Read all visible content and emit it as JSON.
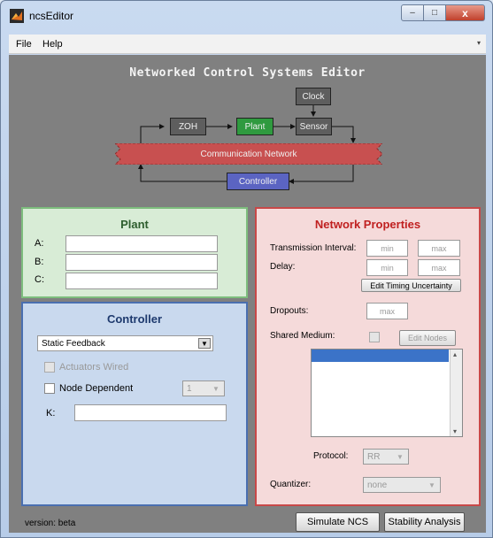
{
  "window": {
    "title": "ncsEditor",
    "min_glyph": "–",
    "max_glyph": "□",
    "close_glyph": "x"
  },
  "menu": {
    "file": "File",
    "help": "Help",
    "arrow_glyph": "▾"
  },
  "app_title": "Networked Control Systems Editor",
  "diagram": {
    "clock": "Clock",
    "zoh": "ZOH",
    "plant": "Plant",
    "sensor": "Sensor",
    "network": "Communication Network",
    "controller": "Controller",
    "colors": {
      "zoh": "#5e5e5e",
      "plant": "#2f9a3f",
      "sensor": "#5e5e5e",
      "clock": "#5e5e5e",
      "network": "#c85050",
      "controller": "#5b64c2"
    }
  },
  "plant_panel": {
    "title": "Plant",
    "a_label": "A:",
    "b_label": "B:",
    "c_label": "C:",
    "a_value": "",
    "b_value": "",
    "c_value": "",
    "bg_color": "#d8ecd6",
    "border_color": "#7dbd7d",
    "title_color": "#2e5e2e"
  },
  "controller_panel": {
    "title": "Controller",
    "type_selected": "Static Feedback",
    "actuators_wired": "Actuators Wired",
    "node_dependent": "Node Dependent",
    "node_count": "1",
    "k_label": "K:",
    "k_value": "",
    "bg_color": "#c9d9ee",
    "border_color": "#4a6fb0",
    "title_color": "#1e3a6e"
  },
  "network_panel": {
    "title": "Network Properties",
    "transmission_interval": "Transmission Interval:",
    "ti_min_placeholder": "min",
    "ti_max_placeholder": "max",
    "delay": "Delay:",
    "delay_min_placeholder": "min",
    "delay_max_placeholder": "max",
    "edit_timing": "Edit Timing Uncertainty",
    "dropouts": "Dropouts:",
    "dropouts_max_placeholder": "max",
    "shared_medium": "Shared Medium:",
    "edit_nodes": "Edit Nodes",
    "scroll_up_glyph": "▴",
    "scroll_down_glyph": "▾",
    "protocol": "Protocol:",
    "protocol_selected": "RR",
    "quantizer": "Quantizer:",
    "quantizer_selected": "none",
    "bg_color": "#f5dada",
    "border_color": "#c84848",
    "title_color": "#c02020"
  },
  "footer": {
    "version": "version: beta",
    "simulate": "Simulate NCS",
    "stability": "Stability Analysis"
  }
}
